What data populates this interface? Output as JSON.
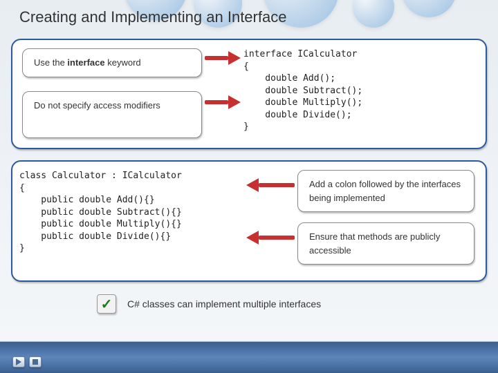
{
  "title": "Creating and Implementing an Interface",
  "notes": {
    "use_keyword_pre": "Use the ",
    "use_keyword_bold": "interface",
    "use_keyword_post": " keyword",
    "no_modifiers": "Do not specify access modifiers",
    "add_colon": "Add a colon followed by the interfaces being implemented",
    "ensure_public": "Ensure that methods are publicly accessible"
  },
  "code": {
    "interface_decl": "interface ICalculator\n{\n    double Add();\n    double Subtract();\n    double Multiply();\n    double Divide();\n}",
    "class_decl": "class Calculator : ICalculator\n{\n    public double Add(){}\n    public double Subtract(){}\n    public double Multiply(){}\n    public double Divide(){}\n}"
  },
  "footer_note": "C# classes can implement multiple interfaces",
  "check_glyph": "✓"
}
